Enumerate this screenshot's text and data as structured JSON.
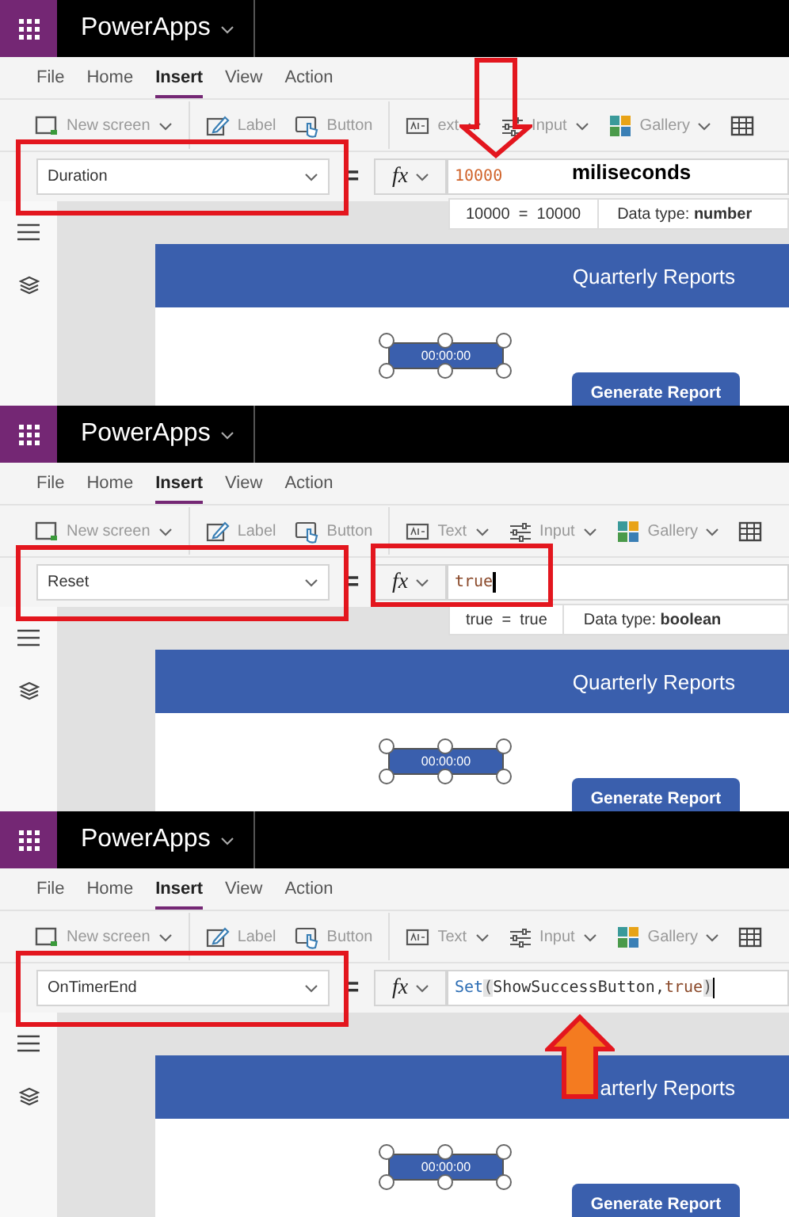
{
  "panels": [
    {
      "app_title": "PowerApps",
      "menu": [
        {
          "label": "File",
          "selected": false
        },
        {
          "label": "Home",
          "selected": false
        },
        {
          "label": "Insert",
          "selected": true
        },
        {
          "label": "View",
          "selected": false
        },
        {
          "label": "Action",
          "selected": false
        }
      ],
      "toolbar": [
        {
          "label": "New screen",
          "dropdown": true
        },
        {
          "label": "Label",
          "dropdown": false
        },
        {
          "label": "Button",
          "dropdown": false
        },
        {
          "label": "ext",
          "dropdown": true
        },
        {
          "label": "Input",
          "dropdown": true
        },
        {
          "label": "Gallery",
          "dropdown": true
        }
      ],
      "property": "Duration",
      "operator": "=",
      "fx_label": "fx",
      "formula": [
        {
          "text": "10000",
          "kind": "number"
        }
      ],
      "cursor": false,
      "note": "miliseconds",
      "hint": {
        "result": "10000  =  10000",
        "type_label": "Data type:",
        "type_value": "number"
      },
      "header": "Quarterly Reports",
      "timer": "00:00:00",
      "button": "Generate Report",
      "highlight_property": true,
      "highlight_formula": false,
      "arrow": {
        "kind": "down_outline"
      }
    },
    {
      "app_title": "PowerApps",
      "menu": [
        {
          "label": "File",
          "selected": false
        },
        {
          "label": "Home",
          "selected": false
        },
        {
          "label": "Insert",
          "selected": true
        },
        {
          "label": "View",
          "selected": false
        },
        {
          "label": "Action",
          "selected": false
        }
      ],
      "toolbar": [
        {
          "label": "New screen",
          "dropdown": true
        },
        {
          "label": "Label",
          "dropdown": false
        },
        {
          "label": "Button",
          "dropdown": false
        },
        {
          "label": "Text",
          "dropdown": true
        },
        {
          "label": "Input",
          "dropdown": true
        },
        {
          "label": "Gallery",
          "dropdown": true
        }
      ],
      "property": "Reset",
      "operator": "=",
      "fx_label": "fx",
      "formula": [
        {
          "text": "true",
          "kind": "literal"
        }
      ],
      "cursor": true,
      "hint": {
        "result": "true  =  true",
        "type_label": "Data type:",
        "type_value": "boolean"
      },
      "header": "Quarterly Reports",
      "timer": "00:00:00",
      "button": "Generate Report",
      "highlight_property": true,
      "highlight_formula": true
    },
    {
      "app_title": "PowerApps",
      "menu": [
        {
          "label": "File",
          "selected": false
        },
        {
          "label": "Home",
          "selected": false
        },
        {
          "label": "Insert",
          "selected": true
        },
        {
          "label": "View",
          "selected": false
        },
        {
          "label": "Action",
          "selected": false
        }
      ],
      "toolbar": [
        {
          "label": "New screen",
          "dropdown": true
        },
        {
          "label": "Label",
          "dropdown": false
        },
        {
          "label": "Button",
          "dropdown": false
        },
        {
          "label": "Text",
          "dropdown": true
        },
        {
          "label": "Input",
          "dropdown": true
        },
        {
          "label": "Gallery",
          "dropdown": true
        }
      ],
      "property": "OnTimerEnd",
      "operator": "=",
      "fx_label": "fx",
      "formula": [
        {
          "text": "Set",
          "kind": "function"
        },
        {
          "text": "(",
          "kind": "paren"
        },
        {
          "text": "ShowSuccessButton",
          "kind": "identifier"
        },
        {
          "text": ",",
          "kind": "identifier"
        },
        {
          "text": "true",
          "kind": "literal"
        },
        {
          "text": ")",
          "kind": "paren"
        }
      ],
      "cursor": true,
      "header": "arterly Reports",
      "timer": "00:00:00",
      "button": "Generate Report",
      "highlight_property": true,
      "highlight_formula": false,
      "arrow": {
        "kind": "up_filled"
      }
    }
  ]
}
